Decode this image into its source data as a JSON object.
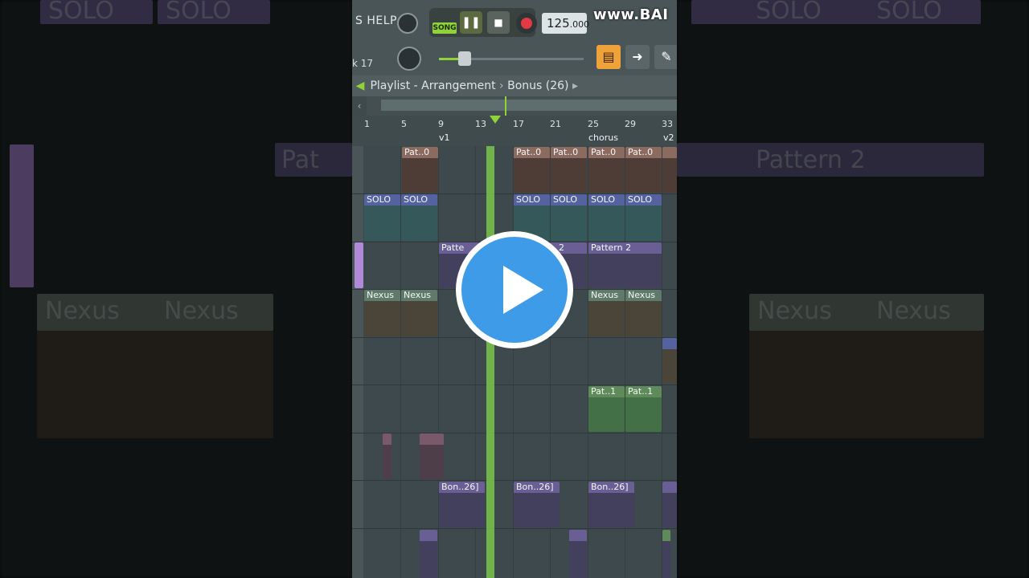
{
  "toolbar": {
    "menu_help": "S HELP",
    "song_label": "SONG",
    "tempo_main": "125",
    "tempo_frac": ".000",
    "watermark": "www.BAI",
    "track_name": "k 17",
    "play_glyph": "❚❚",
    "stop_glyph": "■",
    "arrow_glyph": "➜"
  },
  "playlist": {
    "title": "Playlist - Arrangement",
    "pattern": "Bonus (26)",
    "ruler_ticks": [
      "1",
      "5",
      "9",
      "13",
      "17",
      "21",
      "25",
      "29",
      "33"
    ],
    "markers": [
      "v1",
      "chorus",
      "v2"
    ]
  },
  "clips": [
    {
      "label": "Pat..0",
      "lane": 0
    },
    {
      "label": "Pat..0",
      "lane": 0
    },
    {
      "label": "Pat..0",
      "lane": 0
    },
    {
      "label": "Pat..0",
      "lane": 0
    },
    {
      "label": "Pat..0",
      "lane": 0
    },
    {
      "label": "SOLO",
      "lane": 1
    },
    {
      "label": "SOLO",
      "lane": 1
    },
    {
      "label": "SOLO",
      "lane": 1
    },
    {
      "label": "SOLO",
      "lane": 1
    },
    {
      "label": "SOLO",
      "lane": 1
    },
    {
      "label": "SOLO",
      "lane": 1
    },
    {
      "label": "Patte",
      "lane": 2
    },
    {
      "label": "2",
      "lane": 2
    },
    {
      "label": "Pattern 2",
      "lane": 2
    },
    {
      "label": "Nexus",
      "lane": 3
    },
    {
      "label": "Nexus",
      "lane": 3
    },
    {
      "label": "Nexus",
      "lane": 3
    },
    {
      "label": "Nexus",
      "lane": 3
    },
    {
      "label": "Pat..1",
      "lane": 5
    },
    {
      "label": "Pat..1",
      "lane": 5
    },
    {
      "label": "Bon..26]",
      "lane": 7
    },
    {
      "label": "Bon..26]",
      "lane": 7
    },
    {
      "label": "Bon..26]",
      "lane": 7
    }
  ],
  "background_labels": [
    "SOLO",
    "SOLO",
    "SOLO",
    "SOLO",
    "Pat",
    "Pattern 2",
    "Nexus",
    "Nexus",
    "Nexus",
    "Nexus"
  ],
  "colors": {
    "accent_green": "#8fd23a",
    "clip_brown": "#6b4f47",
    "clip_teal": "#3e6a6a",
    "clip_purple": "#5a4f7a",
    "clip_olive": "#5f5a44",
    "clip_green": "#4f7a4f",
    "play_overlay": "#3d9be8"
  },
  "overlay": {
    "icon": "play-icon"
  }
}
